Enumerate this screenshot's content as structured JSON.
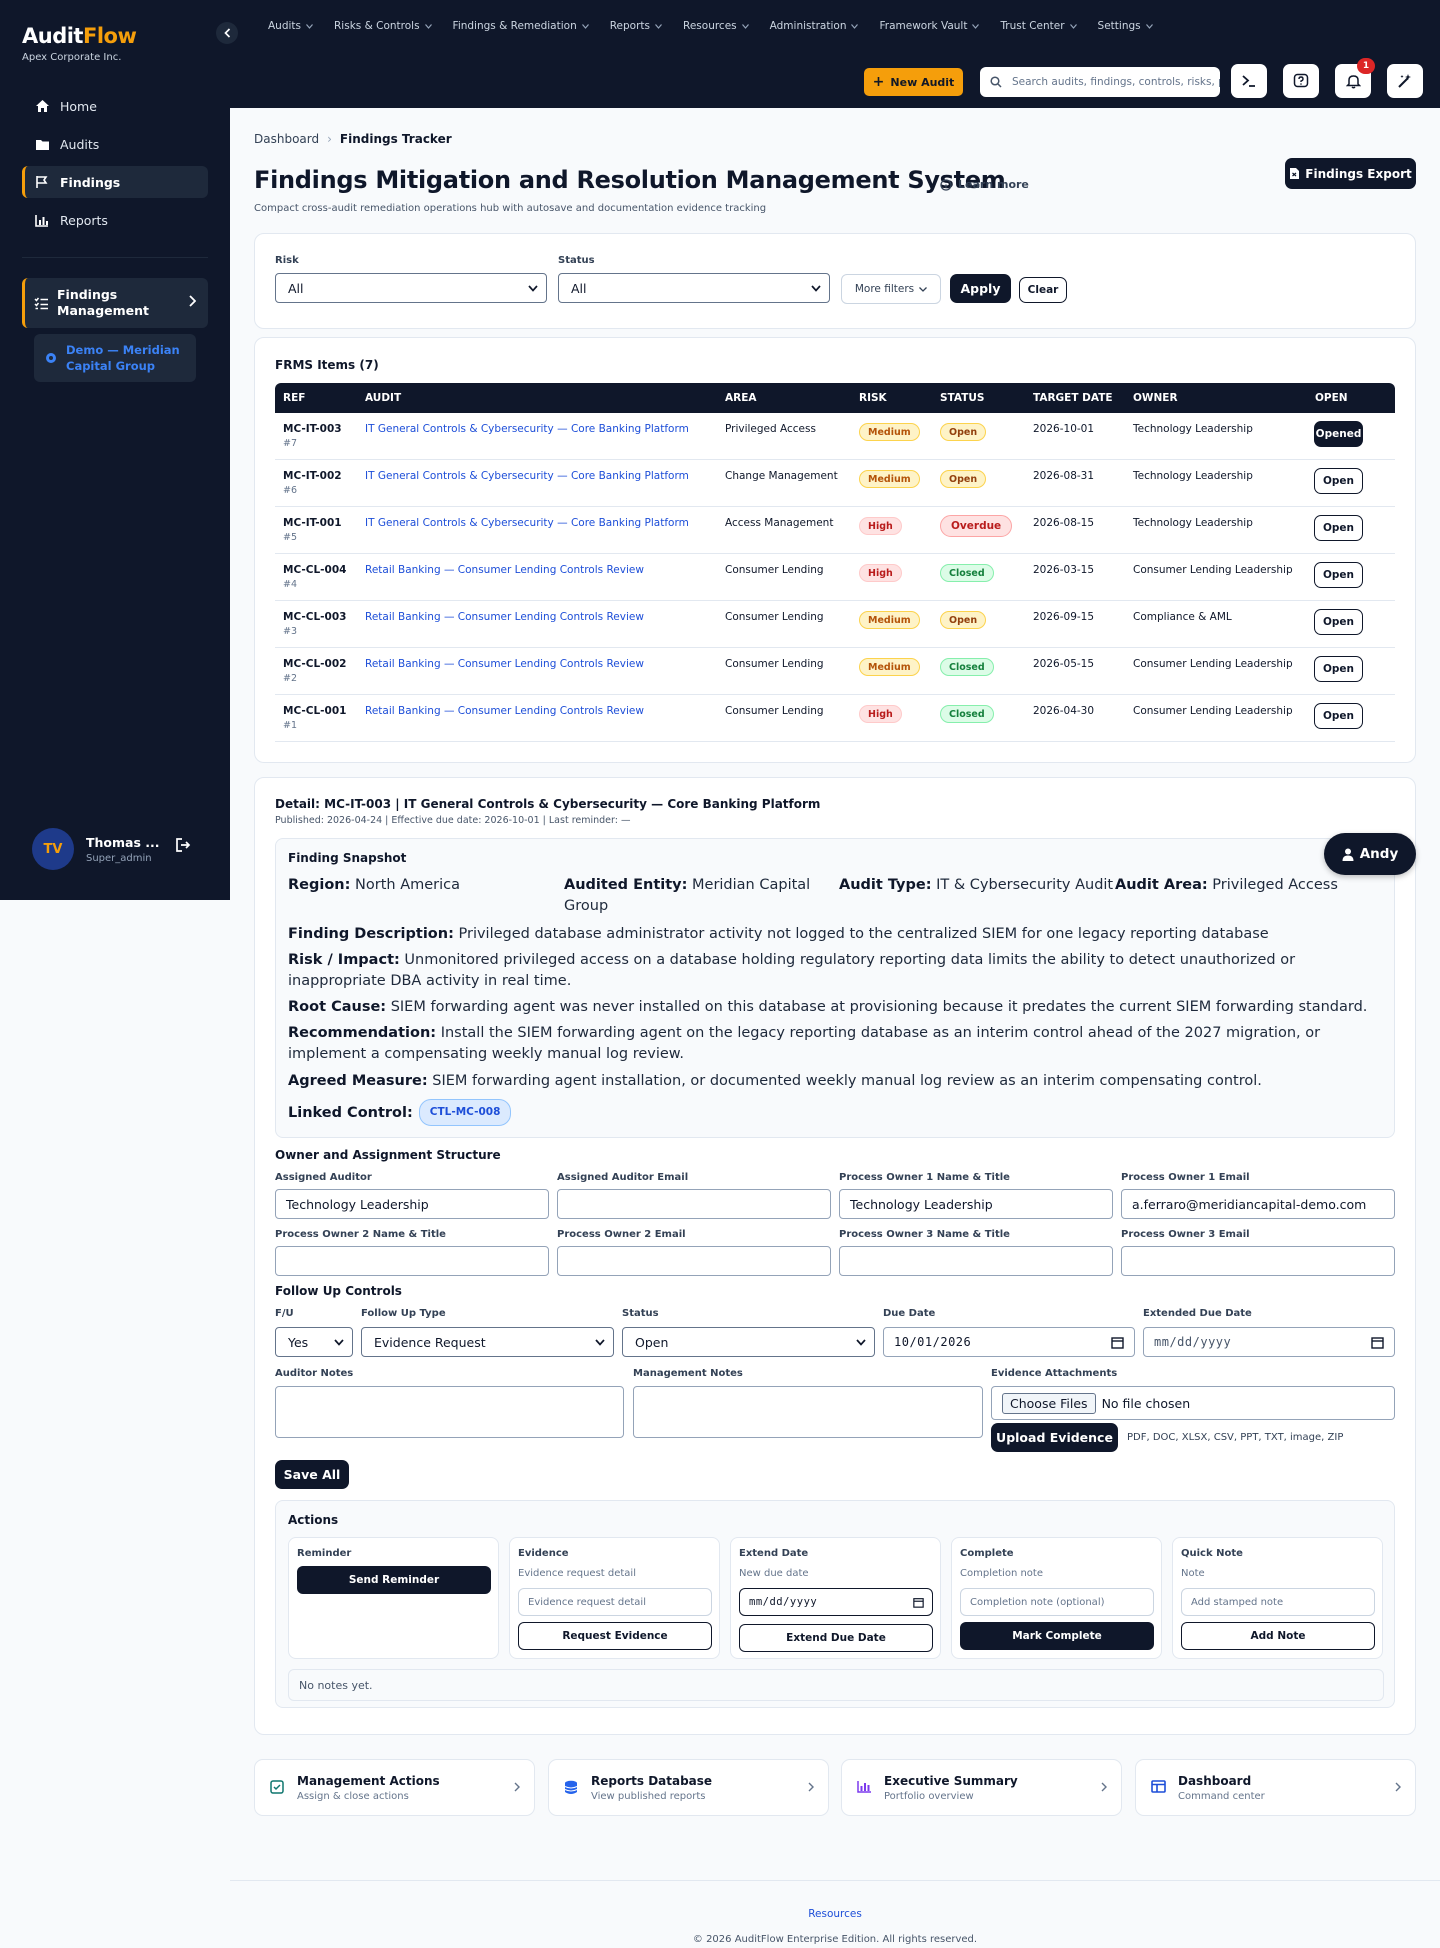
{
  "sidebar": {
    "brand_a": "Audit",
    "brand_b": "Flow",
    "company": "Apex Corporate Inc.",
    "nav": [
      {
        "label": "Home",
        "icon": "home-icon"
      },
      {
        "label": "Audits",
        "icon": "folder-icon"
      },
      {
        "label": "Findings",
        "icon": "flag-icon",
        "active": true
      },
      {
        "label": "Reports",
        "icon": "chart-icon"
      }
    ],
    "findings_mgmt": "Findings Management",
    "demo_client": "Demo — Meridian Capital Group",
    "user": {
      "initials": "TV",
      "name": "Thomas ...",
      "role": "Super_admin"
    }
  },
  "topbar": {
    "menus": [
      "Audits",
      "Risks & Controls",
      "Findings & Remediation",
      "Reports",
      "Resources",
      "Administration",
      "Framework Vault",
      "Trust Center",
      "Settings"
    ],
    "new_audit": "New Audit",
    "search_placeholder": "Search audits, findings, controls, risks, p",
    "notifications": "1"
  },
  "breadcrumb": {
    "root": "Dashboard",
    "current": "Findings Tracker"
  },
  "page": {
    "title": "Findings Mitigation and Resolution Management System",
    "learn_more": "Learn more",
    "subtitle": "Compact cross-audit remediation operations hub with autosave and documentation evidence tracking",
    "export": "Findings Export"
  },
  "filters": {
    "risk_label": "Risk",
    "risk_value": "All",
    "status_label": "Status",
    "status_value": "All",
    "more": "More filters",
    "apply": "Apply",
    "clear": "Clear"
  },
  "table": {
    "title": "FRMS Items (7)",
    "headers": [
      "REF",
      "AUDIT",
      "AREA",
      "RISK",
      "STATUS",
      "TARGET DATE",
      "OWNER",
      "OPEN"
    ],
    "rows": [
      {
        "ref": "MC-IT-003",
        "num": "#7",
        "audit": "IT General Controls & Cybersecurity — Core Banking Platform",
        "area": "Privileged Access",
        "risk": "Medium",
        "status": "Open",
        "date": "2026-10-01",
        "owner": "Technology Leadership",
        "action": "Opened"
      },
      {
        "ref": "MC-IT-002",
        "num": "#6",
        "audit": "IT General Controls & Cybersecurity — Core Banking Platform",
        "area": "Change Management",
        "risk": "Medium",
        "status": "Open",
        "date": "2026-08-31",
        "owner": "Technology Leadership",
        "action": "Open"
      },
      {
        "ref": "MC-IT-001",
        "num": "#5",
        "audit": "IT General Controls & Cybersecurity — Core Banking Platform",
        "area": "Access Management",
        "risk": "High",
        "status": "Overdue",
        "date": "2026-08-15",
        "owner": "Technology Leadership",
        "action": "Open"
      },
      {
        "ref": "MC-CL-004",
        "num": "#4",
        "audit": "Retail Banking — Consumer Lending Controls Review",
        "area": "Consumer Lending",
        "risk": "High",
        "status": "Closed",
        "date": "2026-03-15",
        "owner": "Consumer Lending Leadership",
        "action": "Open"
      },
      {
        "ref": "MC-CL-003",
        "num": "#3",
        "audit": "Retail Banking — Consumer Lending Controls Review",
        "area": "Consumer Lending",
        "risk": "Medium",
        "status": "Open",
        "date": "2026-09-15",
        "owner": "Compliance & AML",
        "action": "Open"
      },
      {
        "ref": "MC-CL-002",
        "num": "#2",
        "audit": "Retail Banking — Consumer Lending Controls Review",
        "area": "Consumer Lending",
        "risk": "Medium",
        "status": "Closed",
        "date": "2026-05-15",
        "owner": "Consumer Lending Leadership",
        "action": "Open"
      },
      {
        "ref": "MC-CL-001",
        "num": "#1",
        "audit": "Retail Banking — Consumer Lending Controls Review",
        "area": "Consumer Lending",
        "risk": "High",
        "status": "Closed",
        "date": "2026-04-30",
        "owner": "Consumer Lending Leadership",
        "action": "Open"
      }
    ]
  },
  "detail": {
    "title": "Detail: MC-IT-003 | IT General Controls & Cybersecurity — Core Banking Platform",
    "meta": "Published: 2026-04-24 | Effective due date: 2026-10-01 | Last reminder: —",
    "snapshot_title": "Finding Snapshot",
    "region_k": "Region:",
    "region_v": "North America",
    "entity_k": "Audited Entity:",
    "entity_v": "Meridian Capital Group",
    "type_k": "Audit Type:",
    "type_v": "IT & Cybersecurity Audit",
    "area_k": "Audit Area:",
    "area_v": "Privileged Access",
    "desc_k": "Finding Description:",
    "desc_v": "Privileged database administrator activity not logged to the centralized SIEM for one legacy reporting database",
    "risk_k": "Risk / Impact:",
    "risk_v": "Unmonitored privileged access on a database holding regulatory reporting data limits the ability to detect unauthorized or inappropriate DBA activity in real time.",
    "root_k": "Root Cause:",
    "root_v": "SIEM forwarding agent was never installed on this database at provisioning because it predates the current SIEM forwarding standard.",
    "rec_k": "Recommendation:",
    "rec_v": "Install the SIEM forwarding agent on the legacy reporting database as an interim control ahead of the 2027 migration, or implement a compensating weekly manual log review.",
    "agreed_k": "Agreed Measure:",
    "agreed_v": "SIEM forwarding agent installation, or documented weekly manual log review as an interim compensating control.",
    "linked_k": "Linked Control:",
    "linked_v": "CTL-MC-008",
    "assistant": "Andy"
  },
  "owners": {
    "section": "Owner and Assignment Structure",
    "fields": [
      {
        "label": "Assigned Auditor",
        "value": "Technology Leadership"
      },
      {
        "label": "Assigned Auditor Email",
        "value": ""
      },
      {
        "label": "Process Owner 1 Name & Title",
        "value": "Technology Leadership"
      },
      {
        "label": "Process Owner 1 Email",
        "value": "a.ferraro@meridiancapital-demo.com"
      },
      {
        "label": "Process Owner 2 Name & Title",
        "value": ""
      },
      {
        "label": "Process Owner 2 Email",
        "value": ""
      },
      {
        "label": "Process Owner 3 Name & Title",
        "value": ""
      },
      {
        "label": "Process Owner 3 Email",
        "value": ""
      }
    ]
  },
  "followup": {
    "section": "Follow Up Controls",
    "fu_label": "F/U",
    "fu_value": "Yes",
    "type_label": "Follow Up Type",
    "type_value": "Evidence Request",
    "status_label": "Status",
    "status_value": "Open",
    "due_label": "Due Date",
    "due_value": "10/01/2026",
    "ext_label": "Extended Due Date",
    "ext_value": "mm/dd/yyyy",
    "auditor_notes": "Auditor Notes",
    "mgmt_notes": "Management Notes",
    "evidence_label": "Evidence Attachments",
    "choose_files": "Choose Files",
    "no_file": "No file chosen",
    "upload": "Upload Evidence",
    "formats": "PDF, DOC, XLSX, CSV, PPT, TXT, image, ZIP",
    "save_all": "Save All"
  },
  "actions": {
    "title": "Actions",
    "reminder": {
      "title": "Reminder",
      "button": "Send Reminder"
    },
    "evidence": {
      "title": "Evidence",
      "sub": "Evidence request detail",
      "placeholder": "Evidence request detail",
      "button": "Request Evidence"
    },
    "extend": {
      "title": "Extend Date",
      "sub": "New due date",
      "placeholder": "mm/dd/yyyy",
      "button": "Extend Due Date"
    },
    "complete": {
      "title": "Complete",
      "sub": "Completion note",
      "placeholder": "Completion note (optional)",
      "button": "Mark Complete"
    },
    "quicknote": {
      "title": "Quick Note",
      "sub": "Note",
      "placeholder": "Add stamped note",
      "button": "Add Note"
    },
    "notes_empty": "No notes yet."
  },
  "quicklinks": [
    {
      "title": "Management Actions",
      "sub": "Assign & close actions",
      "icon": "checkbox-icon",
      "color": "#0f766e"
    },
    {
      "title": "Reports Database",
      "sub": "View published reports",
      "icon": "database-icon",
      "color": "#2563eb"
    },
    {
      "title": "Executive Summary",
      "sub": "Portfolio overview",
      "icon": "bar-chart-icon",
      "color": "#7c3aed"
    },
    {
      "title": "Dashboard",
      "sub": "Command center",
      "icon": "dashboard-icon",
      "color": "#1d4ed8"
    }
  ],
  "footer": {
    "link": "Resources",
    "copy": "© 2026 AuditFlow Enterprise Edition. All rights reserved."
  },
  "colors": {
    "navy": "#0f172a",
    "amber": "#f59e0b",
    "link": "#1d4ed8"
  }
}
